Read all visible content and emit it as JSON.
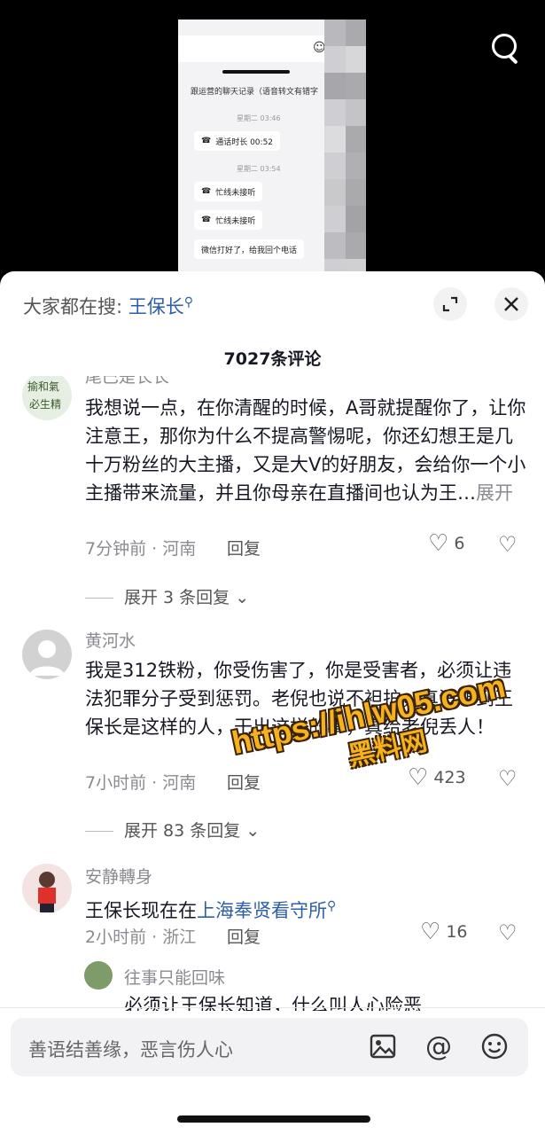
{
  "video": {
    "chat_title": "跟运营的聊天记录（语音转文有错字",
    "messages": [
      {
        "time": "星期二 03:46"
      },
      {
        "text": "通话时长 00:52"
      },
      {
        "time": "星期二 03:54"
      },
      {
        "text": "忙线未接听"
      },
      {
        "text": "忙线未接听"
      },
      {
        "text": "微信打好了，给我回个电话"
      }
    ]
  },
  "search_icon": "search-icon",
  "panel": {
    "hot_prefix": "大家都在搜:",
    "hot_keyword": "王保长",
    "comment_count": "7027条评论"
  },
  "comments": [
    {
      "user": "尾巴是长长",
      "text": "我想说一点，在你清醒的时候，A哥就提醒你了，让你注意王，那你为什么不提高警惕呢，你还幻想王是几十万粉丝的大主播，又是大V的好朋友，会给你一个小主播带来流量，并且你母亲在直播间也认为王…",
      "more": "展开",
      "meta": "7分钟前 · 河南",
      "reply": "回复",
      "likes": "6",
      "expand": "展开 3 条回复"
    },
    {
      "user": "黄河水",
      "text": "我是312铁粉，你受伤害了，你是受害者，必须让违法犯罪分子受到惩罚。老倪也说不袒护，真没想到王保长是这样的人，干出这样的事，真给老倪丢人！",
      "meta": "7小时前 · 河南",
      "reply": "回复",
      "likes": "423",
      "expand": "展开 83 条回复"
    },
    {
      "user": "安静轉身",
      "text_prefix": "王保长现在在",
      "text_link": "上海奉贤看守所",
      "meta": "2小时前 · 浙江",
      "reply": "回复",
      "likes": "16"
    }
  ],
  "sub_comment": {
    "user": "往事只能回味",
    "text": "必须让王保长知道，什么叫人心险恶"
  },
  "watermark": {
    "url": "https://ihlw05.com",
    "name": "黑料网"
  },
  "input": {
    "placeholder": "善语结善缘，恶言伤人心"
  }
}
